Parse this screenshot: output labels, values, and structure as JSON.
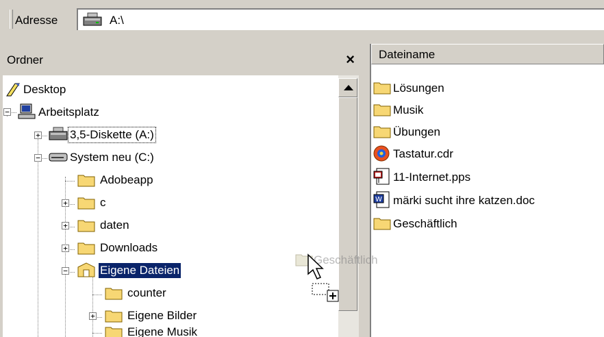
{
  "address_bar": {
    "label": "Adresse",
    "value": "A:\\",
    "icon": "floppy-drive-icon"
  },
  "folders_pane": {
    "title": "Ordner",
    "close_label": "×",
    "tree": [
      {
        "label": "Desktop",
        "icon": "desktop-icon"
      },
      {
        "label": "Arbeitsplatz",
        "icon": "computer-icon",
        "expander": "−"
      },
      {
        "label": "3,5-Diskette (A:)",
        "icon": "floppy-drive-icon",
        "expander": "+"
      },
      {
        "label": "System neu (C:)",
        "icon": "hard-drive-icon",
        "expander": "−"
      },
      {
        "label": "Adobeapp",
        "icon": "folder-icon"
      },
      {
        "label": "c",
        "icon": "folder-icon",
        "expander": "+"
      },
      {
        "label": "daten",
        "icon": "folder-icon",
        "expander": "+"
      },
      {
        "label": "Downloads",
        "icon": "folder-icon",
        "expander": "+"
      },
      {
        "label": "Eigene Dateien",
        "icon": "open-folder-icon",
        "expander": "−"
      },
      {
        "label": "counter",
        "icon": "folder-icon"
      },
      {
        "label": "Eigene Bilder",
        "icon": "folder-icon",
        "expander": "+"
      },
      {
        "label": "Eigene Musik",
        "icon": "folder-icon"
      }
    ]
  },
  "files_pane": {
    "column_header": "Dateiname",
    "files": [
      {
        "name": "Lösungen",
        "icon": "folder-icon"
      },
      {
        "name": "Musik",
        "icon": "folder-icon"
      },
      {
        "name": "Übungen",
        "icon": "folder-icon"
      },
      {
        "name": "Tastatur.cdr",
        "icon": "coreldraw-file-icon"
      },
      {
        "name": "11-Internet.pps",
        "icon": "powerpoint-file-icon"
      },
      {
        "name": "märki sucht ihre katzen.doc",
        "icon": "word-file-icon"
      },
      {
        "name": "Geschäftlich",
        "icon": "folder-icon"
      }
    ]
  },
  "drag_ghost": {
    "label": "Geschäftlich",
    "icon": "folder-icon"
  },
  "colors": {
    "selection": "#0a246a",
    "window_face": "#d4d0c8",
    "folder_yellow": "#f7d774"
  }
}
